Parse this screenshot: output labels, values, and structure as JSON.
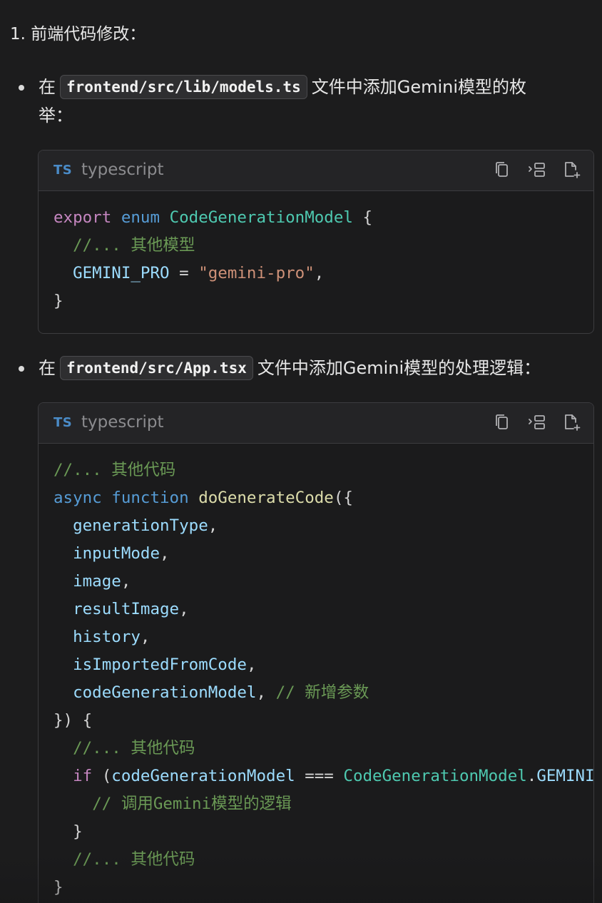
{
  "step_title": "1. 前端代码修改：",
  "bullets": [
    {
      "prefix": "在",
      "code": "frontend/src/lib/models.ts",
      "suffix_line1": "文件中添加Gemini模型的枚",
      "suffix_line2": "举："
    },
    {
      "prefix": "在",
      "code": "frontend/src/App.tsx",
      "suffix_line1": "文件中添加Gemini模型的处理逻辑："
    }
  ],
  "code_blocks": [
    {
      "badge": "TS",
      "language": "typescript",
      "toolbar": [
        "copy-icon",
        "insert-icon",
        "new-file-icon"
      ],
      "lines": [
        [
          [
            "kw-pink",
            "export"
          ],
          [
            "punc",
            " "
          ],
          [
            "kw-blue",
            "enum"
          ],
          [
            "punc",
            " "
          ],
          [
            "type",
            "CodeGenerationModel"
          ],
          [
            "punc",
            " {"
          ]
        ],
        [
          [
            "punc",
            "  "
          ],
          [
            "cmt",
            "//... 其他模型"
          ]
        ],
        [
          [
            "punc",
            "  "
          ],
          [
            "var",
            "GEMINI_PRO"
          ],
          [
            "punc",
            " = "
          ],
          [
            "str",
            "\"gemini-pro\""
          ],
          [
            "punc",
            ","
          ]
        ],
        [
          [
            "punc",
            "}"
          ]
        ]
      ]
    },
    {
      "badge": "TS",
      "language": "typescript",
      "toolbar": [
        "copy-icon",
        "insert-icon",
        "new-file-icon"
      ],
      "lines": [
        [
          [
            "cmt",
            "//... 其他代码"
          ]
        ],
        [
          [
            "kw-blue",
            "async"
          ],
          [
            "punc",
            " "
          ],
          [
            "kw-blue",
            "function"
          ],
          [
            "punc",
            " "
          ],
          [
            "fn",
            "doGenerateCode"
          ],
          [
            "punc",
            "({"
          ]
        ],
        [
          [
            "punc",
            "  "
          ],
          [
            "var",
            "generationType"
          ],
          [
            "punc",
            ","
          ]
        ],
        [
          [
            "punc",
            "  "
          ],
          [
            "var",
            "inputMode"
          ],
          [
            "punc",
            ","
          ]
        ],
        [
          [
            "punc",
            "  "
          ],
          [
            "var",
            "image"
          ],
          [
            "punc",
            ","
          ]
        ],
        [
          [
            "punc",
            "  "
          ],
          [
            "var",
            "resultImage"
          ],
          [
            "punc",
            ","
          ]
        ],
        [
          [
            "punc",
            "  "
          ],
          [
            "var",
            "history"
          ],
          [
            "punc",
            ","
          ]
        ],
        [
          [
            "punc",
            "  "
          ],
          [
            "var",
            "isImportedFromCode"
          ],
          [
            "punc",
            ","
          ]
        ],
        [
          [
            "punc",
            "  "
          ],
          [
            "var",
            "codeGenerationModel"
          ],
          [
            "punc",
            ", "
          ],
          [
            "cmt",
            "// 新增参数"
          ]
        ],
        [
          [
            "punc",
            "}) {"
          ]
        ],
        [
          [
            "punc",
            "  "
          ],
          [
            "cmt",
            "//... 其他代码"
          ]
        ],
        [
          [
            "punc",
            "  "
          ],
          [
            "kw-pink",
            "if"
          ],
          [
            "punc",
            " ("
          ],
          [
            "var",
            "codeGenerationModel"
          ],
          [
            "punc",
            " === "
          ],
          [
            "type",
            "CodeGenerationModel"
          ],
          [
            "punc",
            "."
          ],
          [
            "var",
            "GEMINI_PRO"
          ],
          [
            "punc",
            ") {"
          ]
        ],
        [
          [
            "punc",
            "    "
          ],
          [
            "cmt",
            "// 调用Gemini模型的逻辑"
          ]
        ],
        [
          [
            "punc",
            "  }"
          ]
        ],
        [
          [
            "punc",
            "  "
          ],
          [
            "cmt",
            "//... 其他代码"
          ]
        ],
        [
          [
            "punc",
            "}"
          ]
        ]
      ]
    }
  ]
}
